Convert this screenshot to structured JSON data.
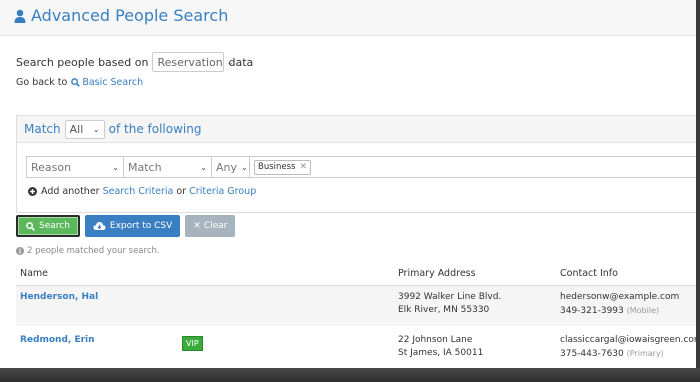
{
  "header": {
    "title": "Advanced People Search",
    "icon": "user-icon"
  },
  "filter": {
    "prefix": "Search people based on",
    "source_value": "Reservation",
    "suffix": "data"
  },
  "goback": {
    "text": "Go back to",
    "link": "Basic Search"
  },
  "criteria": {
    "match_prefix": "Match",
    "match_value": "All",
    "match_suffix": "of the following",
    "field_value": "Reason",
    "operator_value": "Match",
    "quantifier_value": "Any",
    "tag": "Business",
    "add_prefix": "Add another",
    "add_link1": "Search Criteria",
    "add_or": "or",
    "add_link2": "Criteria Group"
  },
  "buttons": {
    "search": "Search",
    "export": "Export to CSV",
    "clear": "Clear"
  },
  "results": {
    "summary": "2 people matched your search."
  },
  "table": {
    "columns": [
      "Name",
      "Primary Address",
      "Contact Info"
    ],
    "rows": [
      {
        "name": "Henderson, Hal",
        "vip": "",
        "address_line1": "3992 Walker Line Blvd.",
        "address_line2": "Elk River, MN 55330",
        "email": "hedersonw@example.com",
        "phone": "349-321-3993",
        "phone_type": "(Mobile)"
      },
      {
        "name": "Redmond, Erin",
        "vip": "VIP",
        "address_line1": "22 Johnson Lane",
        "address_line2": "St James, IA 50011",
        "email": "classiccargal@iowaisgreen.comx",
        "phone": "375-443-7630",
        "phone_type": "(Primary)"
      }
    ]
  },
  "colors": {
    "accent": "#3a7fc1",
    "success": "#5cb85c",
    "muted": "#a7b4bd"
  }
}
